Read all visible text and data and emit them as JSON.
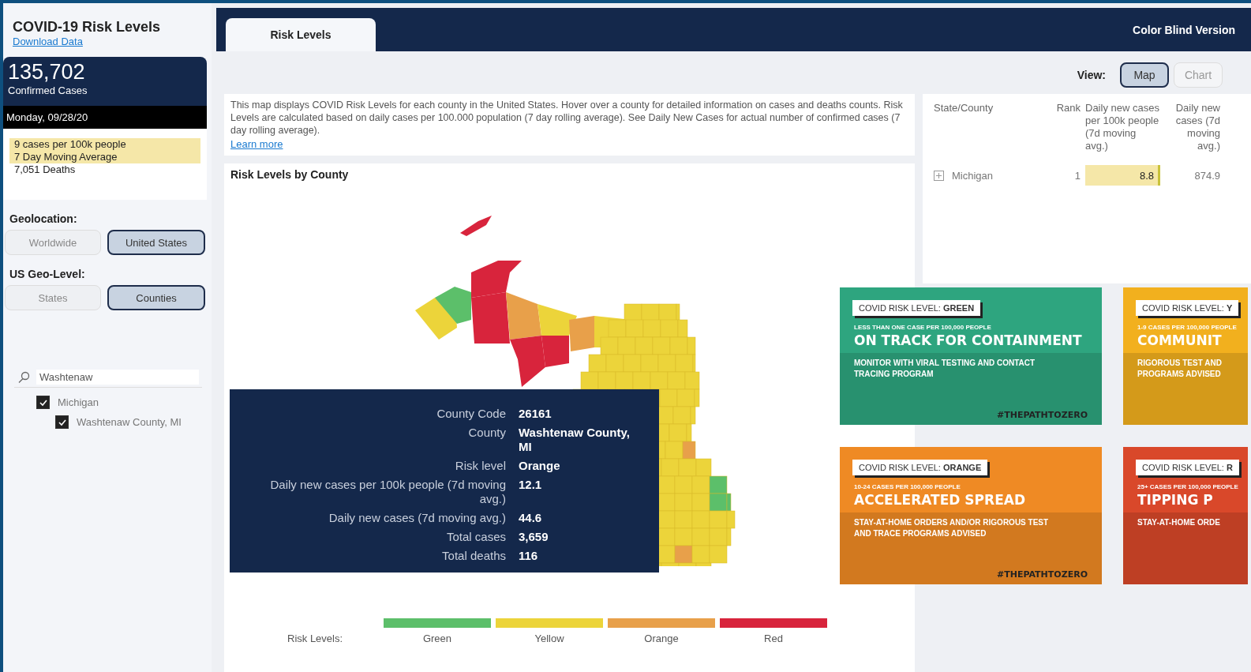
{
  "sidebar": {
    "title": "COVID-19 Risk Levels",
    "download_link": "Download Data",
    "summary": {
      "count": "135,702",
      "count_label": "Confirmed Cases",
      "date": "Monday, 09/28/20"
    },
    "stats": [
      {
        "text": "9 cases per 100k people",
        "highlighted": true
      },
      {
        "text": "7 Day Moving Average",
        "highlighted": true
      },
      {
        "text": "7,051 Deaths",
        "highlighted": false
      }
    ],
    "geolocation": {
      "label": "Geolocation:",
      "options": [
        {
          "label": "Worldwide",
          "selected": false
        },
        {
          "label": "United States",
          "selected": true
        }
      ]
    },
    "geo_level": {
      "label": "US Geo-Level:",
      "options": [
        {
          "label": "States",
          "selected": false
        },
        {
          "label": "Counties",
          "selected": true
        }
      ]
    },
    "search": {
      "value": "Washtenaw"
    },
    "tree": [
      {
        "label": "Michigan",
        "checked": true,
        "children": [
          {
            "label": "Washtenaw County, MI",
            "checked": true
          }
        ]
      }
    ]
  },
  "tabs": [
    {
      "label": "Risk Levels",
      "selected": true
    }
  ],
  "header_link": "Color Blind Version",
  "view": {
    "label": "View:",
    "options": [
      {
        "label": "Map",
        "selected": true
      },
      {
        "label": "Chart",
        "selected": false
      }
    ]
  },
  "description": {
    "text": "This map displays COVID Risk Levels for each county in the United States. Hover over a county for detailed information on cases and deaths counts. Risk Levels are calculated based on daily cases per 100.000 population (7 day rolling average). See Daily New Cases for actual number of confirmed cases (7 day rolling average).",
    "link": "Learn more"
  },
  "map": {
    "title": "Risk Levels by County",
    "tooltip": [
      {
        "label": "County Code",
        "value": "26161"
      },
      {
        "label": "County",
        "value": "Washtenaw County, MI"
      },
      {
        "label": "Risk level",
        "value": "Orange"
      },
      {
        "label": "Daily new cases per 100k people (7d moving avg.)",
        "value": "12.1"
      },
      {
        "label": "Daily new cases (7d moving avg.)",
        "value": "44.6"
      },
      {
        "label": "Total cases",
        "value": "3,659"
      },
      {
        "label": "Total deaths",
        "value": "116"
      }
    ],
    "legend": {
      "label": "Risk Levels:",
      "items": [
        {
          "label": "Green",
          "color": "#5cbf6a"
        },
        {
          "label": "Yellow",
          "color": "#ecd43a"
        },
        {
          "label": "Orange",
          "color": "#e8a04a"
        },
        {
          "label": "Red",
          "color": "#d8243c"
        }
      ]
    }
  },
  "table": {
    "columns": [
      "State/County",
      "Rank",
      "Daily new cases per 100k people (7d moving avg.)",
      "Daily new cases (7d moving avg.)"
    ],
    "rows": [
      {
        "state_county": "Michigan",
        "rank": "1",
        "per_100k": "8.8",
        "daily_new": "874.9"
      }
    ]
  },
  "cards": [
    {
      "color": "#2ea57f",
      "badge": "COVID RISK LEVEL: ",
      "badge_level": "GREEN",
      "subtitle": "LESS THAN ONE CASE PER 100,000 PEOPLE",
      "headline": "ON TRACK FOR CONTAINMENT",
      "advice": "MONITOR WITH VIRAL TESTING AND CONTACT TRACING PROGRAM",
      "hashtag": "#THEPATHTOZERO"
    },
    {
      "color": "#f2b01e",
      "badge": "COVID RISK LEVEL: ",
      "badge_level": "Y",
      "subtitle": "1-9 CASES PER 100,000 PEOPLE",
      "headline": "COMMUNIT",
      "advice": "RIGOROUS TEST AND PROGRAMS ADVISED"
    },
    {
      "color": "#ef8a24",
      "badge": "COVID RISK LEVEL: ",
      "badge_level": "ORANGE",
      "subtitle": "10-24 CASES PER 100,000 PEOPLE",
      "headline": "ACCELERATED SPREAD",
      "advice": "STAY-AT-HOME ORDERS AND/OR RIGOROUS TEST AND TRACE PROGRAMS ADVISED",
      "hashtag": "#THEPATHTOZERO"
    },
    {
      "color": "#d9482a",
      "badge": "COVID RISK LEVEL: ",
      "badge_level": "R",
      "subtitle": "25+ CASES PER 100,000 PEOPLE",
      "headline": "TIPPING P",
      "advice": "STAY-AT-HOME ORDE"
    }
  ]
}
